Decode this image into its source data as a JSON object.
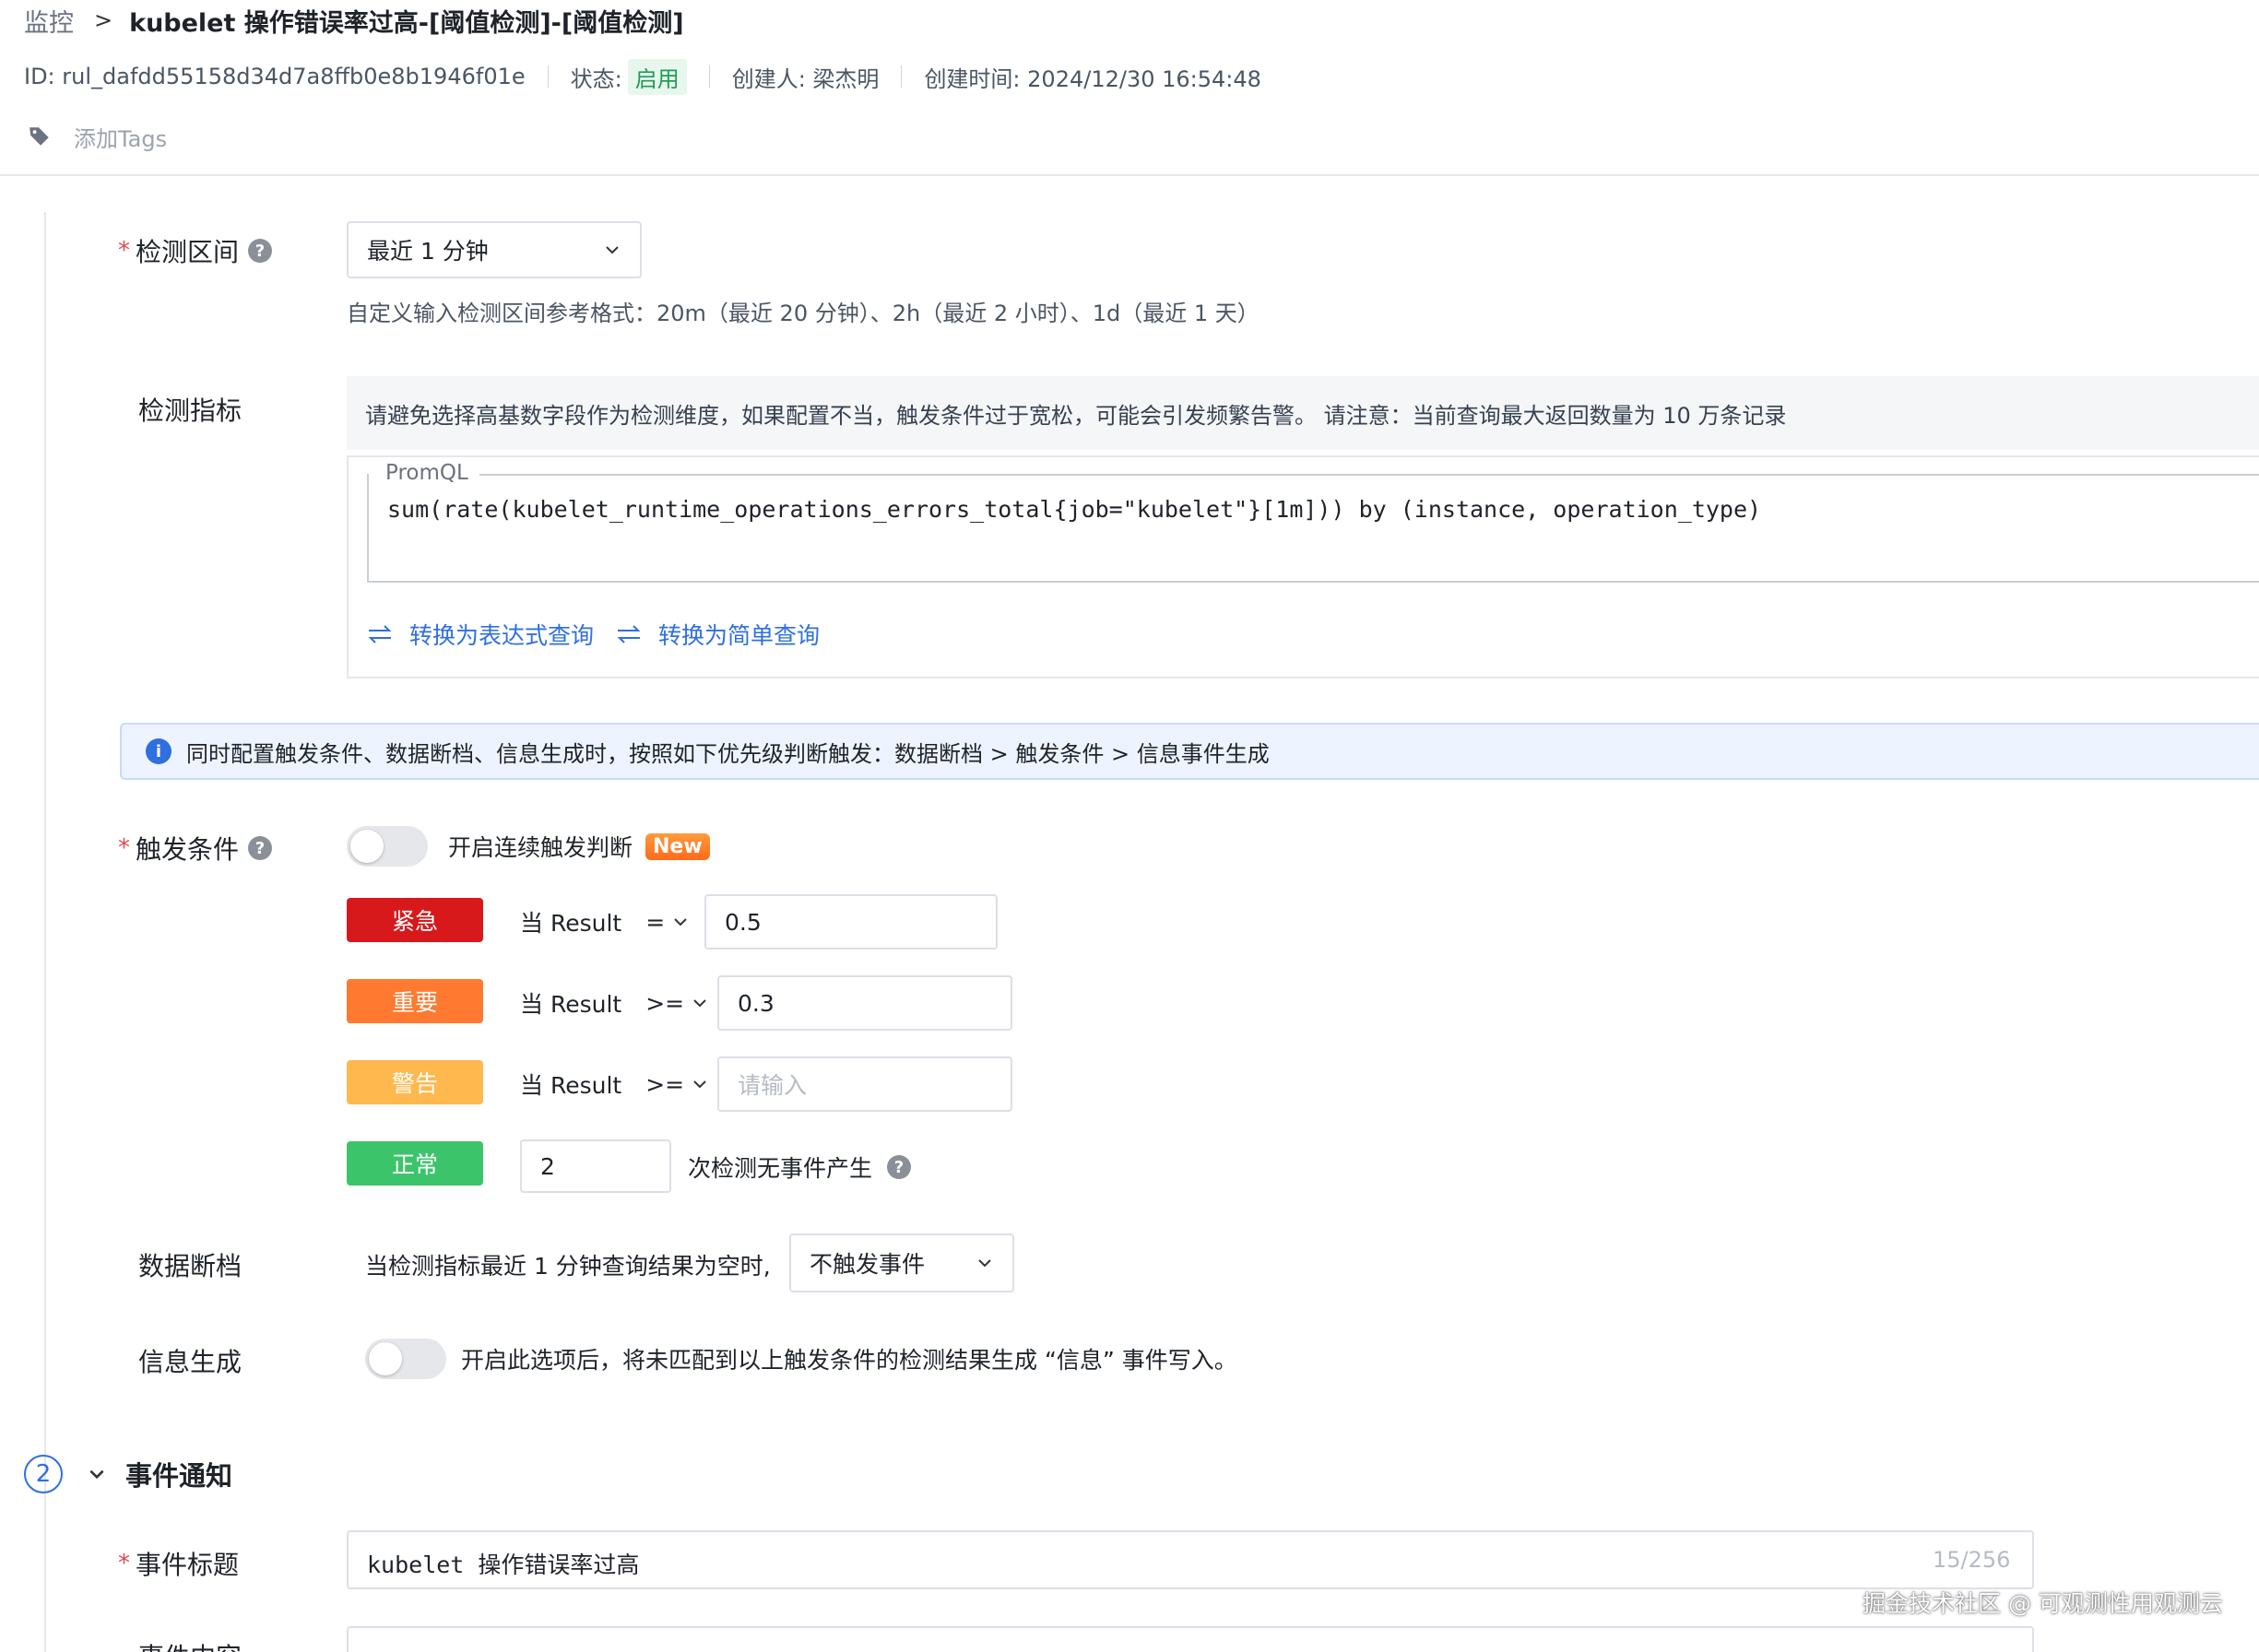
{
  "breadcrumb": {
    "root": "监控",
    "separator": ">",
    "title": "kubelet 操作错误率过高-[阈值检测]-[阈值检测]"
  },
  "meta": {
    "id": "ID: rul_dafdd55158d34d7a8ffb0e8b1946f01e",
    "status_label": "状态:",
    "status_value": "启用",
    "creator": "创建人: 梁杰明",
    "created_at": "创建时间: 2024/12/30 16:54:48"
  },
  "tags": {
    "add_label": "添加Tags"
  },
  "detect_range": {
    "required": "*",
    "label": "检测区间",
    "help": "?",
    "value": "最近 1 分钟",
    "hint": "自定义输入检测区间参考格式：20m（最近 20 分钟）、2h（最近 2 小时）、1d（最近 1 天）"
  },
  "metric": {
    "label": "检测指标",
    "tip": "请避免选择高基数字段作为检测维度，如果配置不当，触发条件过于宽松，可能会引发频繁告警。 请注意：当前查询最大返回数量为 10 万条记录",
    "query_type": "PromQL",
    "query": "sum(rate(kubelet_runtime_operations_errors_total{job=\"kubelet\"}[1m])) by (instance, operation_type)",
    "switch_expression": "转换为表达式查询",
    "switch_simple": "转换为简单查询"
  },
  "info_bar": {
    "icon": "i",
    "text": "同时配置触发条件、数据断档、信息生成时，按照如下优先级判断触发：数据断档 > 触发条件 > 信息事件生成"
  },
  "trigger": {
    "required": "*",
    "label": "触发条件",
    "help": "?",
    "continuous_label": "开启连续触发判断",
    "new_badge": "New",
    "rows": [
      {
        "level": "紧急",
        "color": "#d7191c",
        "when": "当 Result",
        "op": "=",
        "value": "0.5"
      },
      {
        "level": "重要",
        "color": "#ff7a30",
        "when": "当 Result",
        "op": ">=",
        "value": "0.3"
      },
      {
        "level": "警告",
        "color": "#ffb84d",
        "when": "当 Result",
        "op": ">=",
        "placeholder": "请输入"
      }
    ],
    "normal": {
      "level": "正常",
      "color": "#3cc46a",
      "value": "2",
      "suffix": "次检测无事件产生",
      "help": "?"
    }
  },
  "no_data": {
    "label": "数据断档",
    "text": "当检测指标最近 1 分钟查询结果为空时,",
    "value": "不触发事件"
  },
  "info_gen": {
    "label": "信息生成",
    "text": "开启此选项后，将未匹配到以上触发条件的检测结果生成 “信息” 事件写入。"
  },
  "event_notify": {
    "step": "2",
    "title": "事件通知",
    "event_title_label": "事件标题",
    "required": "*",
    "event_title_value": "kubelet 操作错误率过高",
    "counter": "15/256",
    "event_content_label": "事件内容"
  },
  "watermark": "掘金技术社区 @ 可观测性用观测云"
}
